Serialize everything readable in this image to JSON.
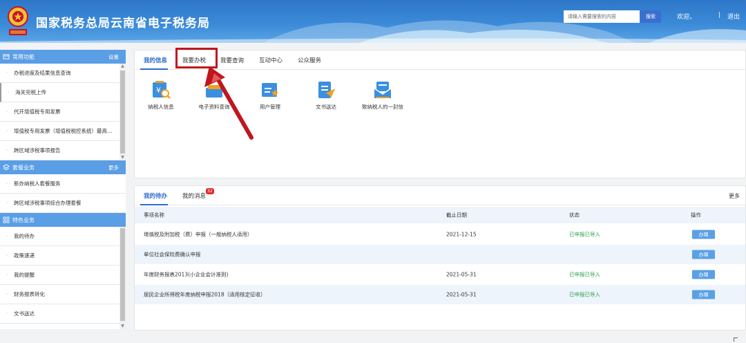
{
  "header": {
    "site_title": "国家税务总局云南省电子税务局",
    "search_placeholder": "请输入需要搜索的内容",
    "search_button": "搜索",
    "welcome": "欢迎，",
    "separator": "|",
    "logout": "退出"
  },
  "sidebar": {
    "common": {
      "title": "常用功能",
      "link": "设置",
      "items": [
        "办税进度及结果信息查询",
        "海关完税上传",
        "代开增值税专用发票",
        "增值税专用发票（增值税税控系统）最高开票限额审批",
        "跨区域涉税事项报告"
      ]
    },
    "package": {
      "title": "套餐业务",
      "link": "更多",
      "items": [
        "新办纳税人套餐服务",
        "跨区域涉税事项综合办理套餐"
      ]
    },
    "special": {
      "title": "特色业务",
      "items": [
        "我的待办",
        "政策速递",
        "我的提醒",
        "财务报表转化",
        "文书送达"
      ]
    }
  },
  "top_tabs": [
    "我的信息",
    "我要办税",
    "我要查询",
    "互动中心",
    "公众服务"
  ],
  "apps": [
    {
      "label": "纳税人信息",
      "icon": "taxpayer-info-icon"
    },
    {
      "label": "电子资料查询",
      "icon": "document-query-icon"
    },
    {
      "label": "用户管理",
      "icon": "user-management-icon"
    },
    {
      "label": "文书送达",
      "icon": "document-delivery-icon"
    },
    {
      "label": "致纳税人的一封信",
      "icon": "letter-icon"
    }
  ],
  "todo": {
    "tabs": [
      "我的待办",
      "我的消息"
    ],
    "message_badge": "32",
    "more": "更多",
    "columns": [
      "事项名称",
      "截止日期",
      "状态",
      "操作"
    ],
    "rows": [
      {
        "name": "增值税及附加税（费）申报（一般纳税人适用）",
        "deadline": "2021-12-15",
        "status": "已申报已导入",
        "action": "办理"
      },
      {
        "name": "单位社会保险费确认申报",
        "deadline": "",
        "status": "",
        "action": "办理"
      },
      {
        "name": "年度财务报表2013(小企业会计准则)",
        "deadline": "2021-05-31",
        "status": "已申报已导入",
        "action": "办理"
      },
      {
        "name": "居民企业所得税年度纳税申报2018（适用核定征收）",
        "deadline": "2021-05-31",
        "status": "已申报已导入",
        "action": "办理"
      }
    ]
  },
  "colors": {
    "header_blue": "#3b8ad8",
    "accent_blue": "#2c6cc8",
    "sidebar_head": "#5a9ee6",
    "highlight_red": "#c0161f",
    "status_green": "#2aa048",
    "badge_red": "#e02b2b"
  }
}
